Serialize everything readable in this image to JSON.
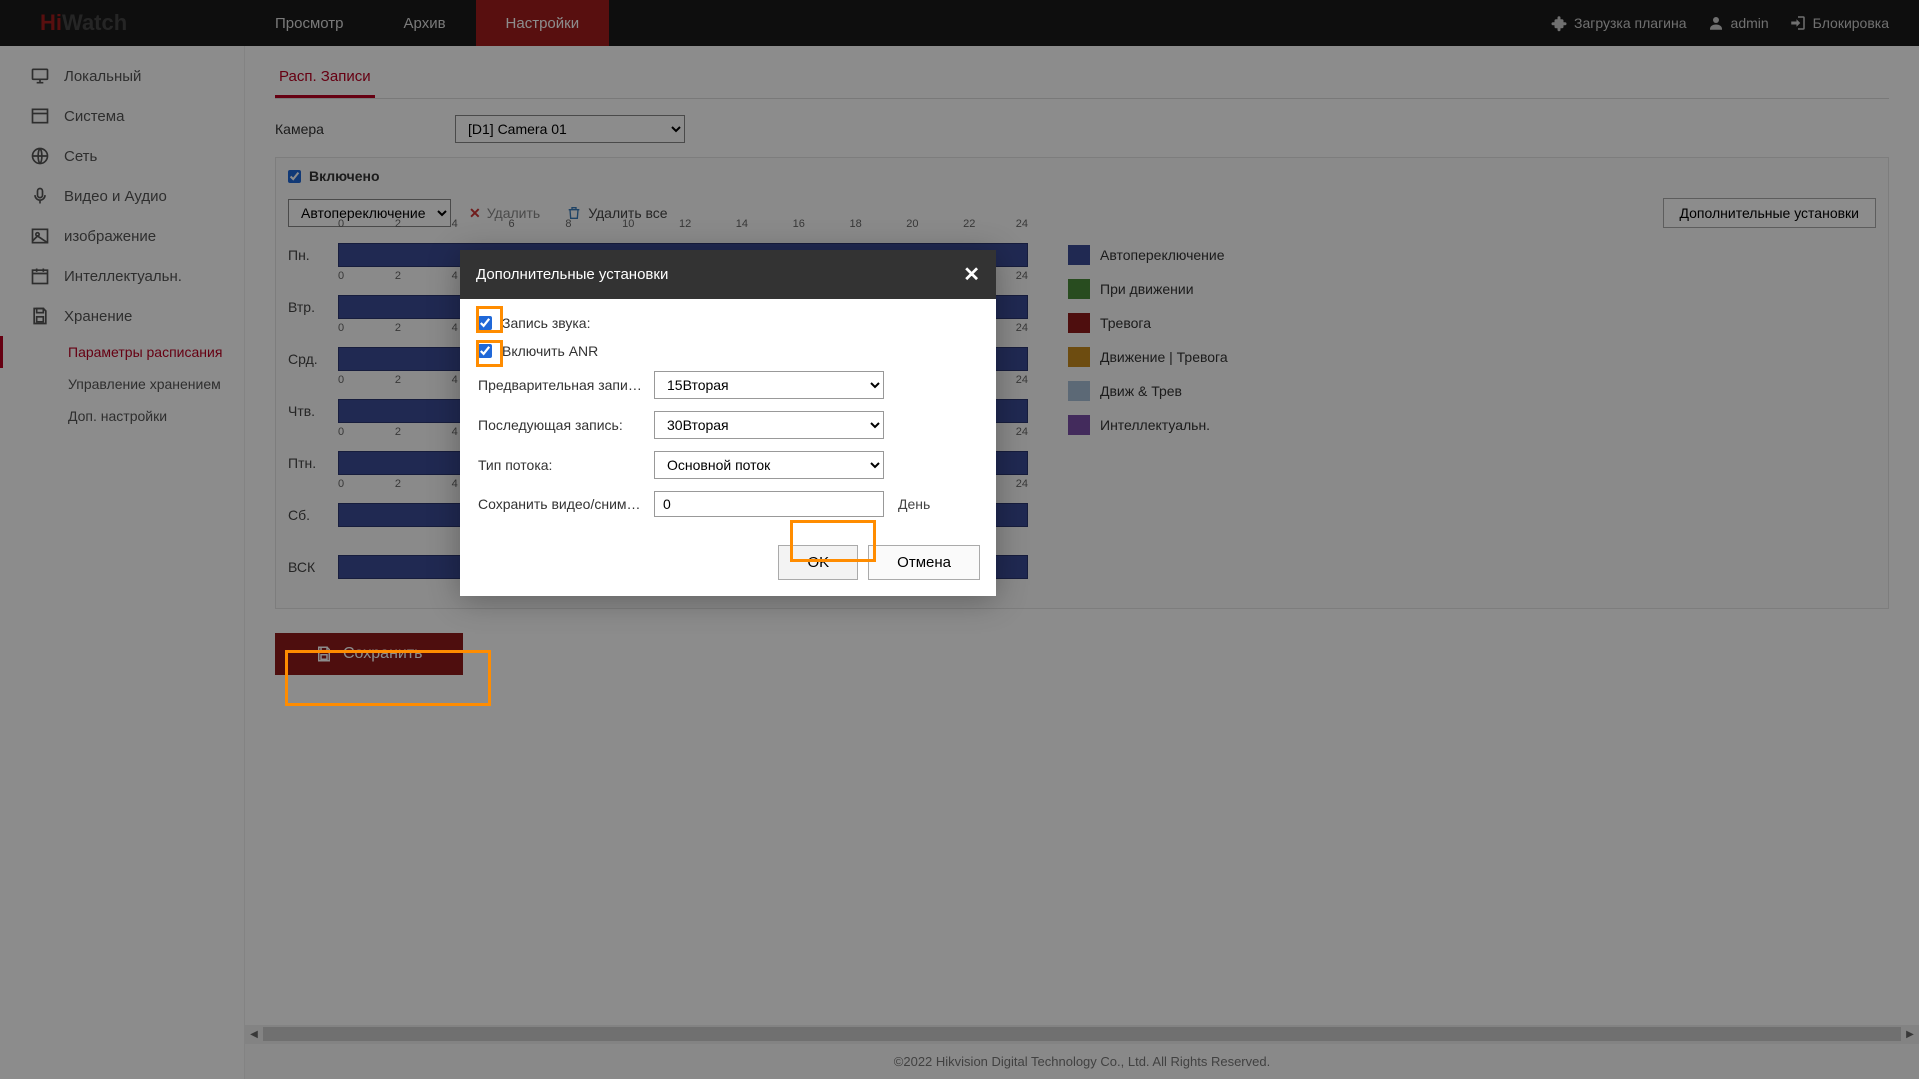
{
  "logo": {
    "hi": "Hi",
    "watch": "Watch"
  },
  "topnav": {
    "live": "Просмотр",
    "playback": "Архив",
    "config": "Настройки"
  },
  "topright": {
    "plugin": "Загрузка плагина",
    "user": "admin",
    "logout": "Блокировка"
  },
  "sidebar": {
    "local": "Локальный",
    "system": "Система",
    "network": "Сеть",
    "va": "Видео и Аудио",
    "image": "изображение",
    "intel": "Интеллектуальн.",
    "storage": "Хранение",
    "sub_schedule": "Параметры расписания",
    "sub_storage": "Управление хранением",
    "sub_adv": "Доп. настройки"
  },
  "tab": "Расп. Записи",
  "camera_label": "Камера",
  "camera_value": "[D1] Camera 01",
  "enable_label": "Включено",
  "stream_switch": "Автопереключение",
  "delete_label": "Удалить",
  "delete_all_label": "Удалить все",
  "advanced_btn": "Дополнительные установки",
  "days": {
    "mon": "Пн.",
    "tue": "Втр.",
    "wed": "Срд.",
    "thu": "Чтв.",
    "fri": "Птн.",
    "sat": "Сб.",
    "sun": "ВСК"
  },
  "hours": [
    "0",
    "2",
    "4",
    "6",
    "8",
    "10",
    "12",
    "14",
    "16",
    "18",
    "20",
    "22",
    "24"
  ],
  "legend": {
    "auto": {
      "label": "Автопереключение",
      "color": "#3b4c95"
    },
    "motion": {
      "label": "При движении",
      "color": "#4a8a3a"
    },
    "alarm": {
      "label": "Тревога",
      "color": "#8f1a1a"
    },
    "mOrA": {
      "label": "Движение | Тревога",
      "color": "#c78a1e"
    },
    "mAndA": {
      "label": "Движ & Трев",
      "color": "#a8c0d8"
    },
    "intel": {
      "label": "Интеллектуальн.",
      "color": "#7a4fa8"
    }
  },
  "save_label": "Сохранить",
  "footer": "©2022 Hikvision Digital Technology Co., Ltd. All Rights Reserved.",
  "modal": {
    "title": "Дополнительные установки",
    "record_audio": "Запись звука:",
    "enable_anr": "Включить ANR",
    "pre_record": "Предварительная запись:",
    "pre_record_val": "15Вторая",
    "post_record": "Последующая запись:",
    "post_record_val": "30Вторая",
    "stream_type": "Тип потока:",
    "stream_type_val": "Основной поток",
    "expiry_label": "Сохранить видео/снимк…",
    "expiry_val": "0",
    "expiry_unit": "День",
    "ok": "OK",
    "cancel": "Отмена"
  }
}
